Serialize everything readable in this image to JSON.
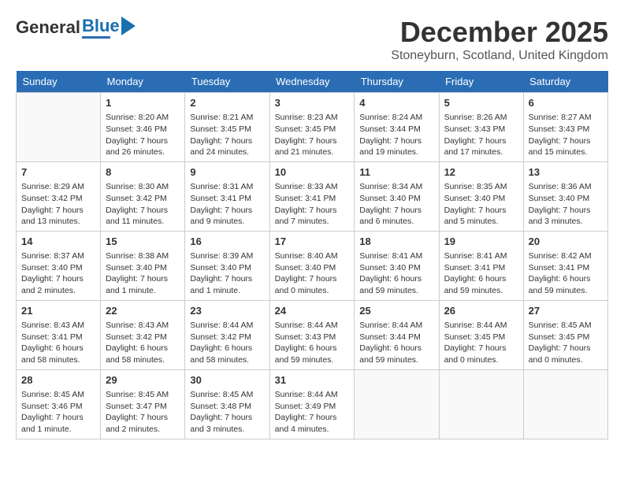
{
  "header": {
    "logo_general": "General",
    "logo_blue": "Blue",
    "month_title": "December 2025",
    "location": "Stoneyburn, Scotland, United Kingdom"
  },
  "days_of_week": [
    "Sunday",
    "Monday",
    "Tuesday",
    "Wednesday",
    "Thursday",
    "Friday",
    "Saturday"
  ],
  "weeks": [
    [
      {
        "day": "",
        "info": ""
      },
      {
        "day": "1",
        "info": "Sunrise: 8:20 AM\nSunset: 3:46 PM\nDaylight: 7 hours\nand 26 minutes."
      },
      {
        "day": "2",
        "info": "Sunrise: 8:21 AM\nSunset: 3:45 PM\nDaylight: 7 hours\nand 24 minutes."
      },
      {
        "day": "3",
        "info": "Sunrise: 8:23 AM\nSunset: 3:45 PM\nDaylight: 7 hours\nand 21 minutes."
      },
      {
        "day": "4",
        "info": "Sunrise: 8:24 AM\nSunset: 3:44 PM\nDaylight: 7 hours\nand 19 minutes."
      },
      {
        "day": "5",
        "info": "Sunrise: 8:26 AM\nSunset: 3:43 PM\nDaylight: 7 hours\nand 17 minutes."
      },
      {
        "day": "6",
        "info": "Sunrise: 8:27 AM\nSunset: 3:43 PM\nDaylight: 7 hours\nand 15 minutes."
      }
    ],
    [
      {
        "day": "7",
        "info": "Sunrise: 8:29 AM\nSunset: 3:42 PM\nDaylight: 7 hours\nand 13 minutes."
      },
      {
        "day": "8",
        "info": "Sunrise: 8:30 AM\nSunset: 3:42 PM\nDaylight: 7 hours\nand 11 minutes."
      },
      {
        "day": "9",
        "info": "Sunrise: 8:31 AM\nSunset: 3:41 PM\nDaylight: 7 hours\nand 9 minutes."
      },
      {
        "day": "10",
        "info": "Sunrise: 8:33 AM\nSunset: 3:41 PM\nDaylight: 7 hours\nand 7 minutes."
      },
      {
        "day": "11",
        "info": "Sunrise: 8:34 AM\nSunset: 3:40 PM\nDaylight: 7 hours\nand 6 minutes."
      },
      {
        "day": "12",
        "info": "Sunrise: 8:35 AM\nSunset: 3:40 PM\nDaylight: 7 hours\nand 5 minutes."
      },
      {
        "day": "13",
        "info": "Sunrise: 8:36 AM\nSunset: 3:40 PM\nDaylight: 7 hours\nand 3 minutes."
      }
    ],
    [
      {
        "day": "14",
        "info": "Sunrise: 8:37 AM\nSunset: 3:40 PM\nDaylight: 7 hours\nand 2 minutes."
      },
      {
        "day": "15",
        "info": "Sunrise: 8:38 AM\nSunset: 3:40 PM\nDaylight: 7 hours\nand 1 minute."
      },
      {
        "day": "16",
        "info": "Sunrise: 8:39 AM\nSunset: 3:40 PM\nDaylight: 7 hours\nand 1 minute."
      },
      {
        "day": "17",
        "info": "Sunrise: 8:40 AM\nSunset: 3:40 PM\nDaylight: 7 hours\nand 0 minutes."
      },
      {
        "day": "18",
        "info": "Sunrise: 8:41 AM\nSunset: 3:40 PM\nDaylight: 6 hours\nand 59 minutes."
      },
      {
        "day": "19",
        "info": "Sunrise: 8:41 AM\nSunset: 3:41 PM\nDaylight: 6 hours\nand 59 minutes."
      },
      {
        "day": "20",
        "info": "Sunrise: 8:42 AM\nSunset: 3:41 PM\nDaylight: 6 hours\nand 59 minutes."
      }
    ],
    [
      {
        "day": "21",
        "info": "Sunrise: 8:43 AM\nSunset: 3:41 PM\nDaylight: 6 hours\nand 58 minutes."
      },
      {
        "day": "22",
        "info": "Sunrise: 8:43 AM\nSunset: 3:42 PM\nDaylight: 6 hours\nand 58 minutes."
      },
      {
        "day": "23",
        "info": "Sunrise: 8:44 AM\nSunset: 3:42 PM\nDaylight: 6 hours\nand 58 minutes."
      },
      {
        "day": "24",
        "info": "Sunrise: 8:44 AM\nSunset: 3:43 PM\nDaylight: 6 hours\nand 59 minutes."
      },
      {
        "day": "25",
        "info": "Sunrise: 8:44 AM\nSunset: 3:44 PM\nDaylight: 6 hours\nand 59 minutes."
      },
      {
        "day": "26",
        "info": "Sunrise: 8:44 AM\nSunset: 3:45 PM\nDaylight: 7 hours\nand 0 minutes."
      },
      {
        "day": "27",
        "info": "Sunrise: 8:45 AM\nSunset: 3:45 PM\nDaylight: 7 hours\nand 0 minutes."
      }
    ],
    [
      {
        "day": "28",
        "info": "Sunrise: 8:45 AM\nSunset: 3:46 PM\nDaylight: 7 hours\nand 1 minute."
      },
      {
        "day": "29",
        "info": "Sunrise: 8:45 AM\nSunset: 3:47 PM\nDaylight: 7 hours\nand 2 minutes."
      },
      {
        "day": "30",
        "info": "Sunrise: 8:45 AM\nSunset: 3:48 PM\nDaylight: 7 hours\nand 3 minutes."
      },
      {
        "day": "31",
        "info": "Sunrise: 8:44 AM\nSunset: 3:49 PM\nDaylight: 7 hours\nand 4 minutes."
      },
      {
        "day": "",
        "info": ""
      },
      {
        "day": "",
        "info": ""
      },
      {
        "day": "",
        "info": ""
      }
    ]
  ]
}
